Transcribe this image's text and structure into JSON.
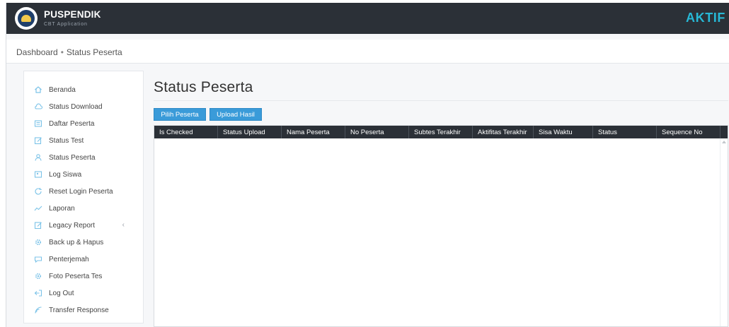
{
  "header": {
    "app_name": "PUSPENDIK",
    "app_subtitle": "CBT Application",
    "status": "AKTIF"
  },
  "breadcrumb": {
    "root": "Dashboard",
    "separator": "•",
    "current": "Status Peserta"
  },
  "sidebar": {
    "items": [
      {
        "label": "Beranda",
        "icon": "home-icon"
      },
      {
        "label": "Status Download",
        "icon": "cloud-icon"
      },
      {
        "label": "Daftar Peserta",
        "icon": "list-icon"
      },
      {
        "label": "Status Test",
        "icon": "edit-icon"
      },
      {
        "label": "Status Peserta",
        "icon": "user-icon"
      },
      {
        "label": "Log Siswa",
        "icon": "log-icon"
      },
      {
        "label": "Reset Login Peserta",
        "icon": "refresh-icon"
      },
      {
        "label": "Laporan",
        "icon": "chart-line-icon"
      },
      {
        "label": "Legacy Report",
        "icon": "report-icon",
        "chevron": "‹"
      },
      {
        "label": "Back up & Hapus",
        "icon": "gear-icon"
      },
      {
        "label": "Penterjemah",
        "icon": "chat-icon"
      },
      {
        "label": "Foto Peserta Tes",
        "icon": "camera-icon"
      },
      {
        "label": "Log Out",
        "icon": "logout-icon"
      },
      {
        "label": "Transfer Response",
        "icon": "signal-icon"
      }
    ]
  },
  "main": {
    "title": "Status Peserta",
    "buttons": {
      "pilih": "Pilih Peserta",
      "upload": "Upload Hasil"
    },
    "table": {
      "columns": [
        "Is Checked",
        "Status Upload",
        "Nama Peserta",
        "No Peserta",
        "Subtes Terakhir",
        "Aktifitas Terakhir",
        "Sisa Waktu",
        "Status",
        "Sequence No"
      ],
      "rows": []
    }
  },
  "colors": {
    "topbar": "#2b3037",
    "accent": "#27b8d6",
    "button": "#3a9bd9",
    "icon": "#7cc3e8"
  }
}
